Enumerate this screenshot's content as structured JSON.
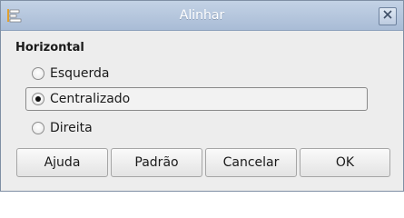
{
  "window": {
    "title": "Alinhar",
    "app_icon": "align-icon",
    "close_icon": "close-icon"
  },
  "horizontal": {
    "section_label": "Horizontal",
    "options": [
      {
        "label": "Esquerda",
        "checked": false
      },
      {
        "label": "Centralizado",
        "checked": true
      },
      {
        "label": "Direita",
        "checked": false
      }
    ]
  },
  "buttons": {
    "help": "Ajuda",
    "default": "Padrão",
    "cancel": "Cancelar",
    "ok": "OK"
  }
}
